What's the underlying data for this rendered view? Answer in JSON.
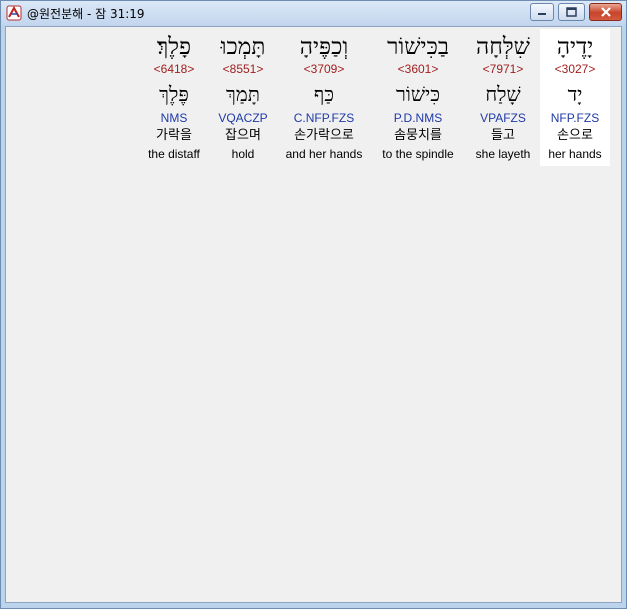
{
  "window": {
    "title": "@원전분해 - 잠 31:19",
    "icon": "app-icon",
    "controls": {
      "minimize": "minimize-icon",
      "maximize": "maximize-icon",
      "close": "close-icon"
    }
  },
  "words": [
    {
      "hebrew": "יָדֶיהָ",
      "strong": "<3027>",
      "lemma": "יָד",
      "morph": "NFP.FZS",
      "korean": "손으로",
      "english": "her hands",
      "highlighted": true
    },
    {
      "hebrew": "שִׁלְּחָה",
      "strong": "<7971>",
      "lemma": "שָׁלַח",
      "morph": "VPAFZS",
      "korean": "들고",
      "english": "she layeth",
      "highlighted": false
    },
    {
      "hebrew": "בַכִּישׁוֹר",
      "strong": "<3601>",
      "lemma": "כִּישׁוֹר",
      "morph": "P.D.NMS",
      "korean": "솜뭉치를",
      "english": "to the spindle",
      "highlighted": false
    },
    {
      "hebrew": "וְכַפֶּיהָ",
      "strong": "<3709>",
      "lemma": "כַּף",
      "morph": "C.NFP.FZS",
      "korean": "손가락으로",
      "english": "and her hands",
      "highlighted": false
    },
    {
      "hebrew": "תָּמְכוּ",
      "strong": "<8551>",
      "lemma": "תָּמַךְ",
      "morph": "VQACZP",
      "korean": "잡으며",
      "english": "hold",
      "highlighted": false
    },
    {
      "hebrew": "פָלֶךְ׃",
      "strong": "<6418>",
      "lemma": "פֶּלֶךְ",
      "morph": "NMS",
      "korean": "가락을",
      "english": "the distaff",
      "highlighted": false
    }
  ],
  "colors": {
    "strong": "#a02020",
    "morph": "#1f3aa8",
    "highlight": "#ffffff"
  }
}
